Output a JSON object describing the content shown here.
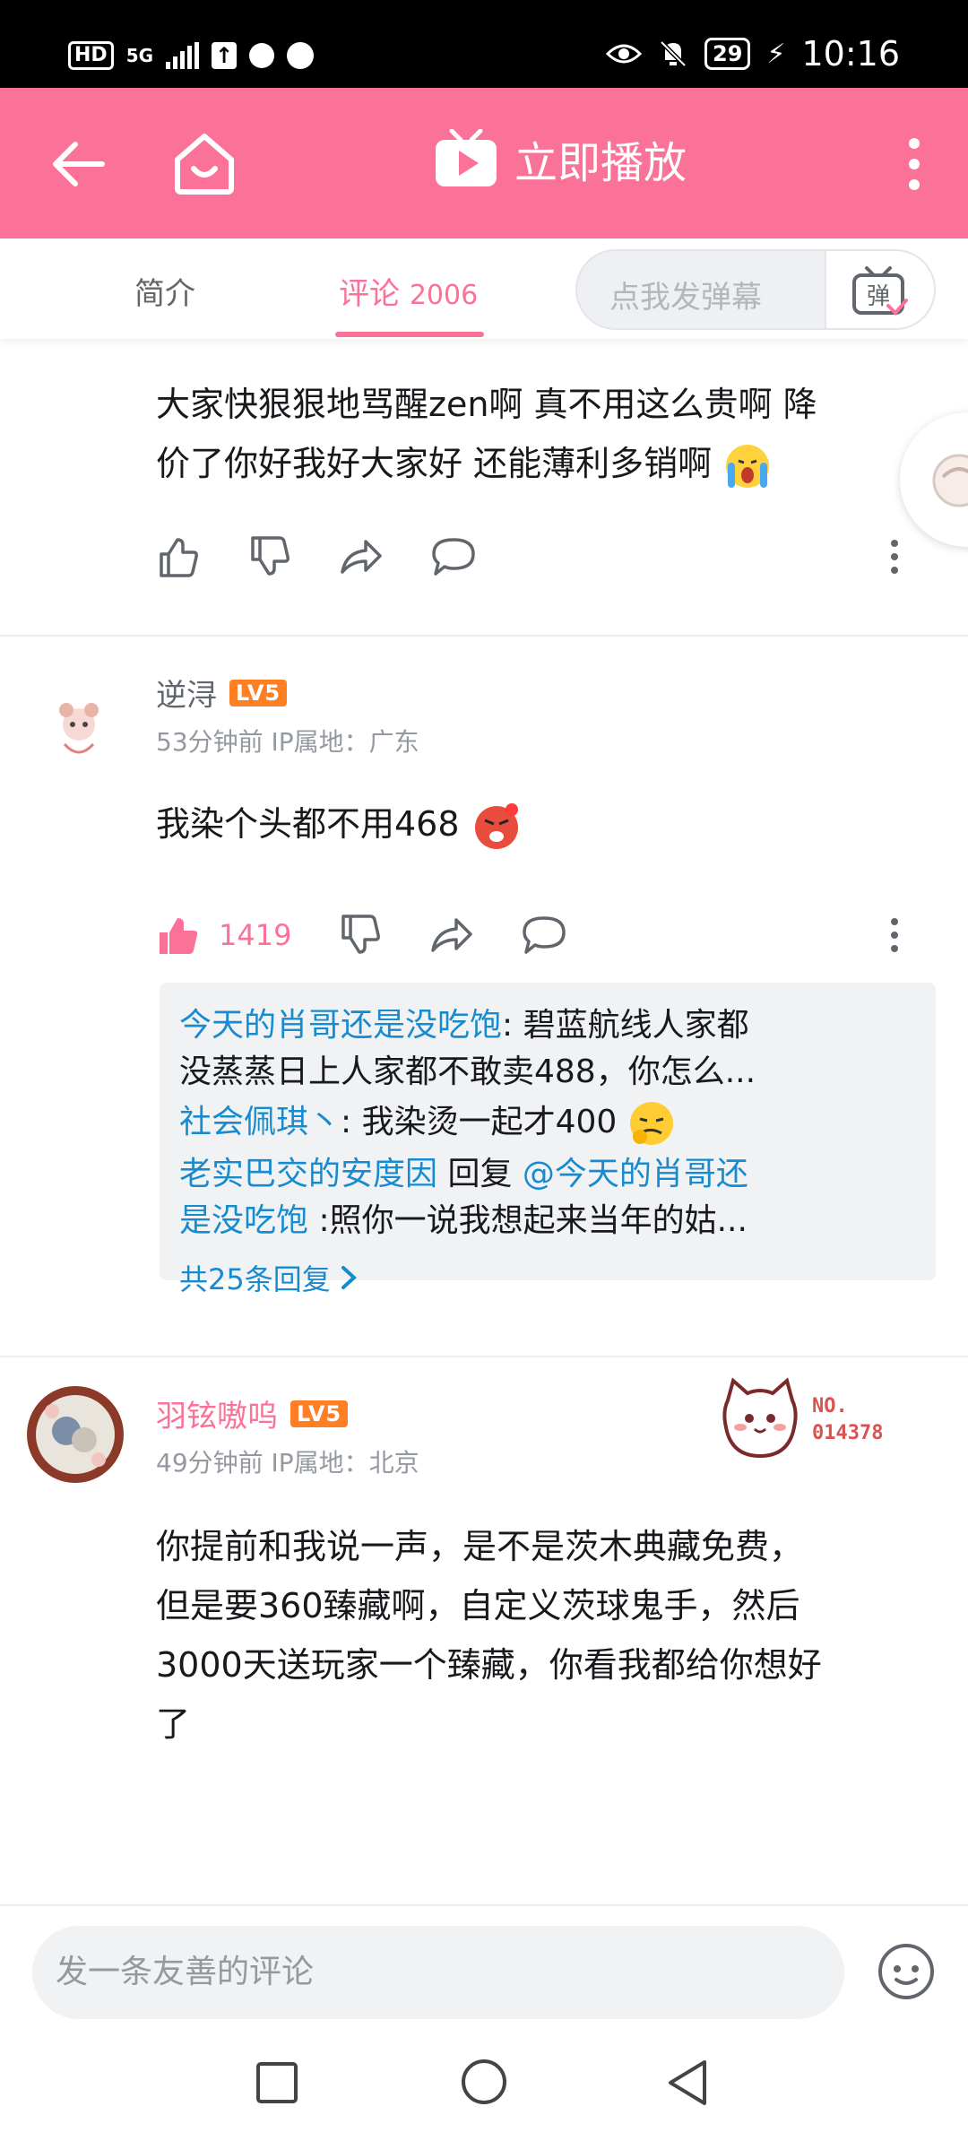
{
  "status_bar": {
    "hd": "HD",
    "network": "5G",
    "battery": "29",
    "time": "10:16"
  },
  "header": {
    "title": "立即播放",
    "back_icon": "back-arrow-icon",
    "home_icon": "home-icon",
    "tv_icon": "tv-play-icon",
    "more_icon": "more-vertical-icon"
  },
  "tabs": {
    "intro": "简介",
    "comments_label": "评论",
    "comments_count": "2006",
    "danmaku_placeholder": "点我发弹幕",
    "danmaku_button": "弹"
  },
  "colors": {
    "accent": "#fb7299",
    "link": "#178bcf"
  },
  "comments": [
    {
      "text": "大家快狠狠地骂醒zen啊 真不用这么贵啊 降价了你好我好大家好 还能薄利多销啊",
      "line1": "大家快狠狠地骂醒zen啊 真不用这么贵啊 降",
      "line2": "价了你好我好大家好 还能薄利多销啊",
      "emoji": "crying-emoji"
    },
    {
      "user": "逆浔",
      "level": "LV5",
      "meta": "53分钟前 IP属地：广东",
      "text": "我染个头都不用468",
      "emoji": "angry-emoji",
      "likes": "1419",
      "replies": [
        {
          "name": "今天的肖哥还是没吃饱",
          "sep": ": ",
          "text_a": "碧蓝航线人家都",
          "text_b": "没蒸蒸日上人家都不敢卖488，你怎么..."
        },
        {
          "name": "社会佩琪丶",
          "sep": ": ",
          "text": "我染烫一起才400"
        },
        {
          "name": "老实巴交的安度因",
          "mid": " 回复 ",
          "mention_a": "@今天的肖哥还",
          "mention_b": "是没吃饱",
          "text": " :照你一说我想起来当年的姑..."
        }
      ],
      "reply_more": "共25条回复"
    },
    {
      "user": "羽铉嗷呜",
      "level": "LV5",
      "meta": "49分钟前 IP属地：北京",
      "badge_no": "NO.",
      "badge_num": "014378",
      "line1": "你提前和我说一声，是不是茨木典藏免费，",
      "line2": "但是要360臻藏啊，自定义茨球鬼手，然后",
      "line3": "3000天送玩家一个臻藏，你看我都给你想好",
      "line4": "了"
    }
  ],
  "bottom": {
    "comment_placeholder": "发一条友善的评论"
  }
}
